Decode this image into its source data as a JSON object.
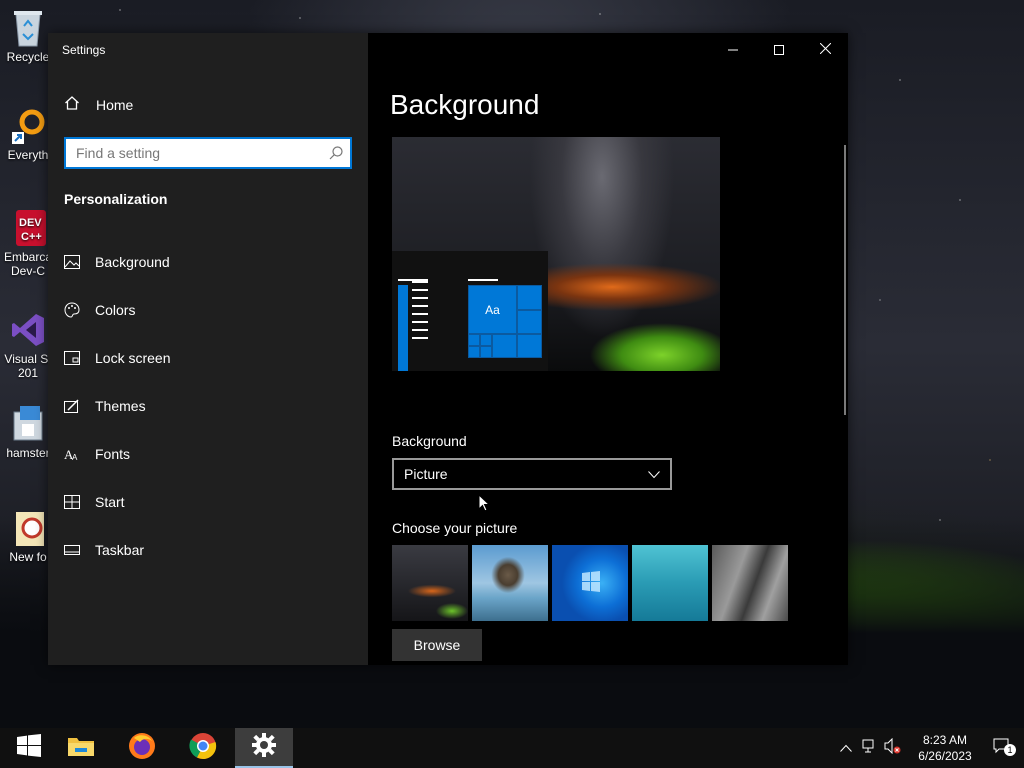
{
  "desktop": {
    "icons": [
      {
        "label": "Recycle",
        "icon": "recycle-bin-icon"
      },
      {
        "label": "Everyth",
        "icon": "everything-search-icon"
      },
      {
        "label": "Embarca Dev-C",
        "icon": "dev-cpp-icon"
      },
      {
        "label": "Visual St 201",
        "icon": "visual-studio-icon"
      },
      {
        "label": "hamster",
        "icon": "hamster-app-icon"
      },
      {
        "label": "New fo",
        "icon": "new-folder-icon"
      }
    ]
  },
  "window": {
    "title": "Settings",
    "sidebar": {
      "home_label": "Home",
      "search_placeholder": "Find a setting",
      "section_title": "Personalization",
      "items": [
        {
          "label": "Background",
          "icon": "picture-icon"
        },
        {
          "label": "Colors",
          "icon": "palette-icon"
        },
        {
          "label": "Lock screen",
          "icon": "lock-screen-icon"
        },
        {
          "label": "Themes",
          "icon": "brush-icon"
        },
        {
          "label": "Fonts",
          "icon": "font-icon"
        },
        {
          "label": "Start",
          "icon": "start-grid-icon"
        },
        {
          "label": "Taskbar",
          "icon": "taskbar-icon"
        }
      ]
    },
    "content": {
      "page_title": "Background",
      "preview_tile_text": "Aa",
      "dropdown_label": "Background",
      "dropdown_value": "Picture",
      "choose_label": "Choose your picture",
      "browse_label": "Browse"
    }
  },
  "taskbar": {
    "apps": [
      "start-icon",
      "file-explorer-icon",
      "firefox-icon",
      "chrome-icon",
      "settings-gear-icon"
    ],
    "clock_time": "8:23 AM",
    "clock_date": "6/26/2023",
    "notification_count": "1"
  },
  "colors": {
    "accent": "#0078d7",
    "sidebar_bg": "#1f1f1f",
    "content_bg": "#000000"
  }
}
